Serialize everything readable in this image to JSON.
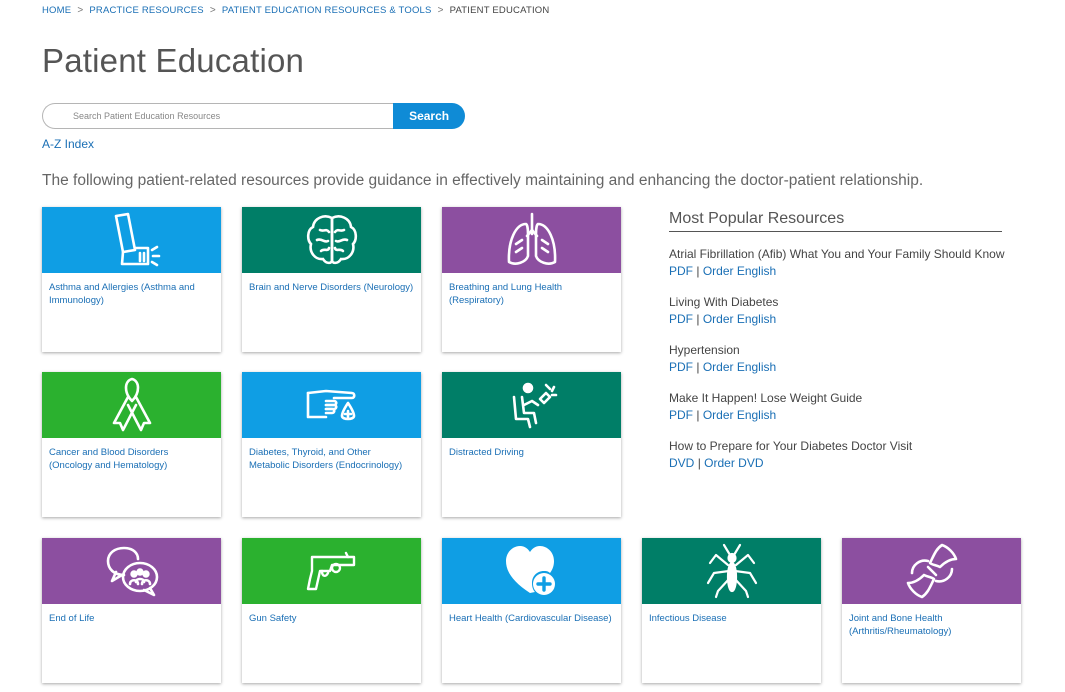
{
  "breadcrumb": {
    "home": "HOME",
    "practice": "PRACTICE RESOURCES",
    "tools": "PATIENT EDUCATION RESOURCES & TOOLS",
    "current": "PATIENT EDUCATION",
    "separator": ">"
  },
  "page_title": "Patient Education",
  "search": {
    "placeholder": "Search Patient Education Resources",
    "button": "Search"
  },
  "az_index": "A-Z Index",
  "intro": "The following patient-related resources provide guidance in effectively maintaining and enhancing the doctor-patient relationship.",
  "colors": {
    "blue": "#0f9ee4",
    "teal": "#007e67",
    "purple": "#8c4fa0",
    "green": "#2bb12f",
    "link": "#1a6fb5"
  },
  "cards": [
    {
      "label": "Asthma and Allergies (Asthma and Immunology)",
      "icon": "inhaler-icon",
      "color": "blue"
    },
    {
      "label": "Brain and Nerve Disorders (Neurology)",
      "icon": "brain-icon",
      "color": "teal"
    },
    {
      "label": "Breathing and Lung Health (Respiratory)",
      "icon": "lungs-icon",
      "color": "purple"
    },
    {
      "label": "Cancer and Blood Disorders (Oncology and Hematology)",
      "icon": "ribbon-icon",
      "color": "green"
    },
    {
      "label": "Diabetes, Thyroid, and Other Metabolic Disorders (Endocrinology)",
      "icon": "finger-prick-icon",
      "color": "blue"
    },
    {
      "label": "Distracted Driving",
      "icon": "distracted-driver-icon",
      "color": "teal"
    },
    {
      "label": "End of Life",
      "icon": "speech-bubbles-icon",
      "color": "purple"
    },
    {
      "label": "Gun Safety",
      "icon": "revolver-icon",
      "color": "green"
    },
    {
      "label": "Heart Health (Cardiovascular Disease)",
      "icon": "heart-plus-icon",
      "color": "blue"
    },
    {
      "label": "Infectious Disease",
      "icon": "mosquito-icon",
      "color": "teal"
    },
    {
      "label": "Joint and Bone Health (Arthritis/Rheumatology)",
      "icon": "joint-icon",
      "color": "purple"
    }
  ],
  "popular": {
    "heading": "Most Popular Resources",
    "items": [
      {
        "title": "Atrial Fibrillation (Afib) What You and Your Family Should Know",
        "link1": "PDF",
        "link2": "Order English"
      },
      {
        "title": "Living With Diabetes",
        "link1": "PDF",
        "link2": "Order English"
      },
      {
        "title": "Hypertension",
        "link1": "PDF",
        "link2": "Order English"
      },
      {
        "title": "Make It Happen! Lose Weight Guide",
        "link1": "PDF",
        "link2": "Order English"
      },
      {
        "title": "How to Prepare for Your Diabetes Doctor Visit",
        "link1": "DVD",
        "link2": "Order DVD"
      }
    ],
    "link_separator": "|"
  }
}
